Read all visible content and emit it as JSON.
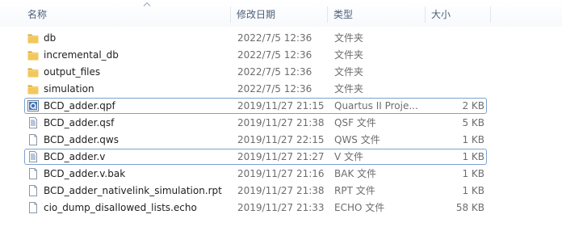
{
  "columns": {
    "name": "名称",
    "date": "修改日期",
    "type": "类型",
    "size": "大小"
  },
  "files": [
    {
      "name": "db",
      "date": "2022/7/5 12:36",
      "type": "文件夹",
      "size": "",
      "icon": "folder-icon"
    },
    {
      "name": "incremental_db",
      "date": "2022/7/5 12:36",
      "type": "文件夹",
      "size": "",
      "icon": "folder-icon"
    },
    {
      "name": "output_files",
      "date": "2022/7/5 12:36",
      "type": "文件夹",
      "size": "",
      "icon": "folder-icon"
    },
    {
      "name": "simulation",
      "date": "2022/7/5 12:36",
      "type": "文件夹",
      "size": "",
      "icon": "folder-icon"
    },
    {
      "name": "BCD_adder.qpf",
      "date": "2019/11/27 21:15",
      "type": "Quartus II Proje...",
      "size": "2 KB",
      "icon": "quartus-project-icon",
      "focused": true
    },
    {
      "name": "BCD_adder.qsf",
      "date": "2019/11/27 21:38",
      "type": "QSF 文件",
      "size": "5 KB",
      "icon": "text-file-icon"
    },
    {
      "name": "BCD_adder.qws",
      "date": "2019/11/27 22:15",
      "type": "QWS 文件",
      "size": "1 KB",
      "icon": "blank-file-icon"
    },
    {
      "name": "BCD_adder.v",
      "date": "2019/11/27 21:27",
      "type": "V 文件",
      "size": "1 KB",
      "icon": "text-file-icon",
      "focused": true
    },
    {
      "name": "BCD_adder.v.bak",
      "date": "2019/11/27 21:16",
      "type": "BAK 文件",
      "size": "1 KB",
      "icon": "blank-file-icon"
    },
    {
      "name": "BCD_adder_nativelink_simulation.rpt",
      "date": "2019/11/27 21:38",
      "type": "RPT 文件",
      "size": "1 KB",
      "icon": "blank-file-icon"
    },
    {
      "name": "cio_dump_disallowed_lists.echo",
      "date": "2019/11/27 21:33",
      "type": "ECHO 文件",
      "size": "58 KB",
      "icon": "blank-file-icon"
    }
  ],
  "colors": {
    "header_text": "#4c607a",
    "focus_border": "#7da2ce",
    "folder": "#e8b838",
    "secondary_text": "#6d6d6d"
  }
}
